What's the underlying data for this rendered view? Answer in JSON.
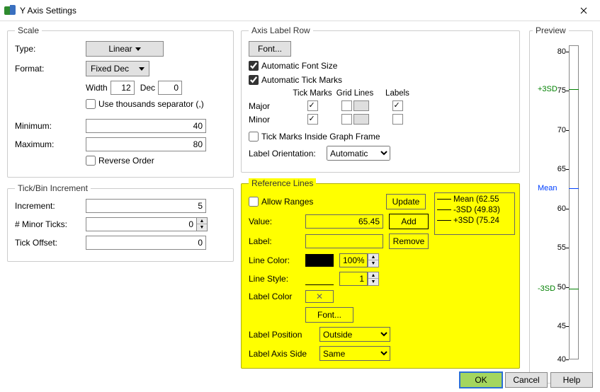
{
  "window": {
    "title": "Y Axis Settings"
  },
  "scale": {
    "legend": "Scale",
    "type_label": "Type:",
    "type_value": "Linear",
    "format_label": "Format:",
    "format_value": "Fixed Dec",
    "width_label": "Width",
    "width_value": "12",
    "dec_label": "Dec",
    "dec_value": "0",
    "thousands_label": "Use thousands separator (,)",
    "thousands_checked": false,
    "min_label": "Minimum:",
    "min_value": "40",
    "max_label": "Maximum:",
    "max_value": "80",
    "reverse_label": "Reverse Order",
    "reverse_checked": false
  },
  "tickbin": {
    "legend": "Tick/Bin Increment",
    "increment_label": "Increment:",
    "increment_value": "5",
    "minor_label": "# Minor Ticks:",
    "minor_value": "0",
    "offset_label": "Tick Offset:",
    "offset_value": "0"
  },
  "axis_label": {
    "legend": "Axis Label Row",
    "font_btn": "Font...",
    "auto_font_label": "Automatic Font Size",
    "auto_tick_label": "Automatic Tick Marks",
    "hdr_tick": "Tick Marks",
    "hdr_grid": "Grid Lines",
    "hdr_labels": "Labels",
    "row_major": "Major",
    "row_minor": "Minor",
    "inside_label": "Tick Marks Inside Graph Frame",
    "orient_label": "Label Orientation:",
    "orient_value": "Automatic"
  },
  "ref": {
    "legend": "Reference Lines",
    "allow_label": "Allow Ranges",
    "update_btn": "Update",
    "add_btn": "Add",
    "remove_btn": "Remove",
    "value_label": "Value:",
    "value_value": "65.45",
    "label_label": "Label:",
    "label_value": "",
    "linecolor_label": "Line Color:",
    "pct_value": "100%",
    "linestyle_label": "Line Style:",
    "linestyle_value": "1",
    "labelcolor_label": "Label Color",
    "font_btn": "Font...",
    "pos_label": "Label Position",
    "pos_value": "Outside",
    "side_label": "Label Axis Side",
    "side_value": "Same",
    "list": [
      {
        "cls": "blue",
        "text": "Mean (62.55"
      },
      {
        "cls": "green",
        "text": "-3SD (49.83)"
      },
      {
        "cls": "green",
        "text": "+3SD (75.24"
      }
    ]
  },
  "preview": {
    "legend": "Preview",
    "ticks": [
      {
        "v": 80,
        "pct": 2
      },
      {
        "v": 75,
        "pct": 14.5
      },
      {
        "v": 70,
        "pct": 27
      },
      {
        "v": 65,
        "pct": 39.5
      },
      {
        "v": 60,
        "pct": 52
      },
      {
        "v": 55,
        "pct": 64.5
      },
      {
        "v": 50,
        "pct": 77
      },
      {
        "v": 45,
        "pct": 89.5
      },
      {
        "v": 40,
        "pct": 100
      }
    ],
    "refs": [
      {
        "label": "+3SD",
        "color": "#008000",
        "pct": 13.9
      },
      {
        "label": "Mean",
        "color": "#0040ff",
        "pct": 45.6
      },
      {
        "label": "-3SD",
        "color": "#008000",
        "pct": 77.4
      }
    ]
  },
  "footer": {
    "ok": "OK",
    "cancel": "Cancel",
    "help": "Help"
  }
}
